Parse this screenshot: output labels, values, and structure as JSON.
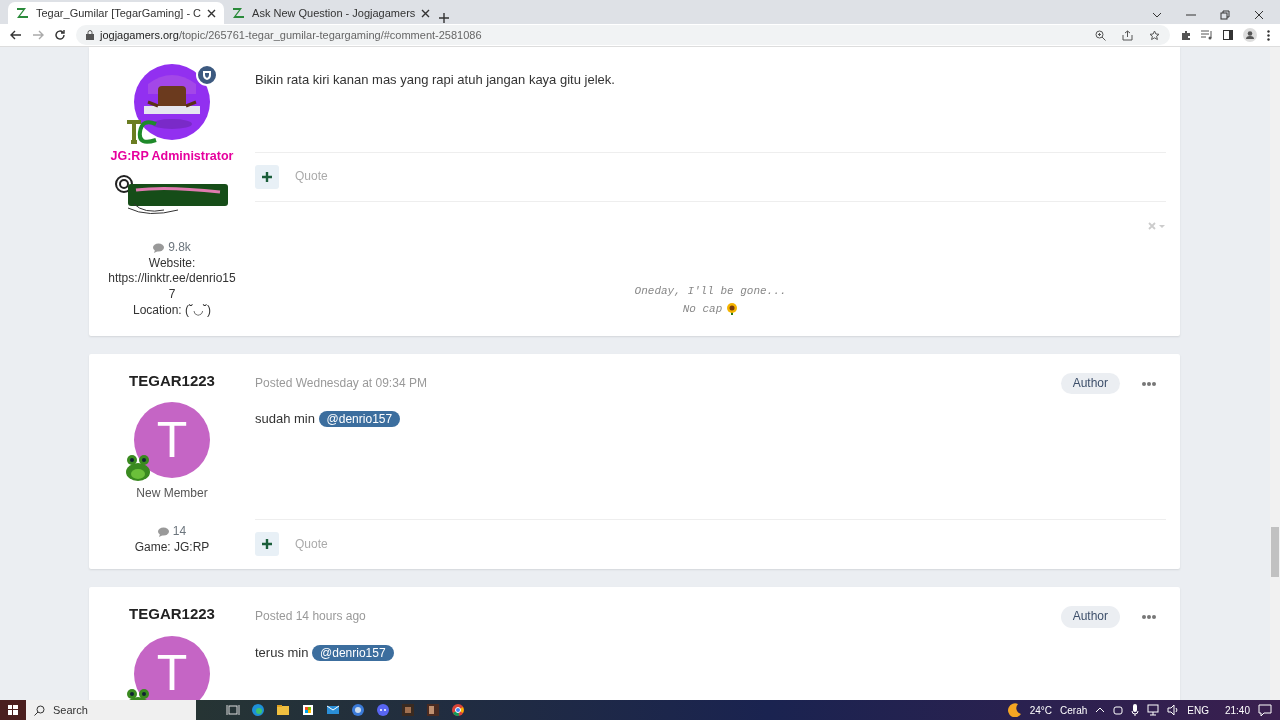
{
  "browser": {
    "tabs": [
      {
        "title": "Tegar_Gumilar [TegarGaming] - C",
        "selected": true
      },
      {
        "title": "Ask New Question - Jogjagamers",
        "selected": false
      }
    ],
    "url_host": "jogjagamers.org",
    "url_path": "/topic/265761-tegar_gumilar-tegargaming/#comment-2581086"
  },
  "posts": [
    {
      "avatar": {
        "kind": "picture"
      },
      "moderator": true,
      "group": {
        "title": "JG:RP Administrator",
        "color": "#e6009e"
      },
      "staff_banner": true,
      "post_count": "9.8k",
      "fields": [
        {
          "label": "Website:",
          "value": "https://linktr.ee/denrio157"
        },
        {
          "label": "Location:",
          "value": "(˘◡˘)"
        }
      ],
      "content": "Bikin rata kiri kanan mas yang rapi atuh jangan kaya gitu jelek.",
      "quote": "Quote",
      "signature": [
        "Oneday, I'll be gone...",
        "No cap"
      ]
    },
    {
      "author": "TEGAR1223",
      "date": "Posted Wednesday at 09:34 PM",
      "badge": "Author",
      "avatar": {
        "kind": "letter",
        "letter": "T"
      },
      "moderator": false,
      "group": {
        "title": "New Member",
        "color": "#555555"
      },
      "staff_banner": false,
      "post_count": "14",
      "fields": [
        {
          "label": "Game:",
          "value": "JG:RP"
        }
      ],
      "content": "sudah min",
      "mention": "@denrio157",
      "quote": "Quote"
    },
    {
      "author": "TEGAR1223",
      "date": "Posted 14 hours ago",
      "badge": "Author",
      "avatar": {
        "kind": "letter",
        "letter": "T"
      },
      "moderator": false,
      "content": "terus min",
      "mention": "@denrio157"
    }
  ],
  "taskbar": {
    "search": "Search",
    "temperature": "24°C",
    "weather": "Cerah",
    "language": "ENG",
    "time": "21:40"
  }
}
